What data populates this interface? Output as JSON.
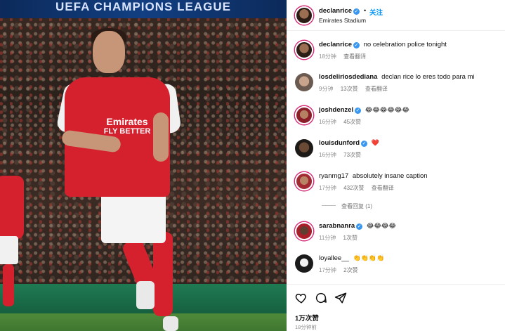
{
  "photo": {
    "banner_text": "UEFA CHAMPIONS LEAGUE",
    "shirt_sponsor_line1": "Emirates",
    "shirt_sponsor_line2": "FLY BETTER"
  },
  "post_header": {
    "username": "declanrice",
    "verified": "✓",
    "separator": "•",
    "follow_label": "关注",
    "location": "Emirates Stadium"
  },
  "comments": [
    {
      "username": "declanrice",
      "verified": true,
      "text": "no celebration police tonight",
      "time": "18分钟",
      "likes": "",
      "translate": "查看翻译"
    },
    {
      "username": "losdeliriosdediana",
      "verified": false,
      "text": "declan rice lo eres todo para mi",
      "time": "9分钟",
      "likes": "13次赞",
      "translate": "查看翻译"
    },
    {
      "username": "joshdenzel",
      "verified": true,
      "text": "😂😂😂😂😂😂",
      "time": "16分钟",
      "likes": "45次赞",
      "translate": ""
    },
    {
      "username": "louisdunford",
      "verified": true,
      "text": "❤️",
      "time": "16分钟",
      "likes": "73次赞",
      "translate": ""
    },
    {
      "username": "ryanmg17",
      "verified": false,
      "text": "absolutely insane caption",
      "time": "17分钟",
      "likes": "432次赞",
      "translate": "查看翻译"
    },
    {
      "username": "sarabnanra",
      "verified": true,
      "text": "😂😂😂😂",
      "time": "11分钟",
      "likes": "1次赞",
      "translate": ""
    },
    {
      "username": "loyallee__",
      "verified": false,
      "text": "👏👏👏👏",
      "time": "17分钟",
      "likes": "2次赞",
      "translate": ""
    }
  ],
  "view_replies": "查看回复 (1)",
  "actions": {
    "like_icon": "heart-icon",
    "comment_icon": "comment-icon",
    "share_icon": "share-icon"
  },
  "likes_count": "1万次赞",
  "post_time": "18分钟前",
  "colors": {
    "link_blue": "#0095f6",
    "verified_blue": "#3897f0",
    "arsenal_red": "#d5202e"
  }
}
